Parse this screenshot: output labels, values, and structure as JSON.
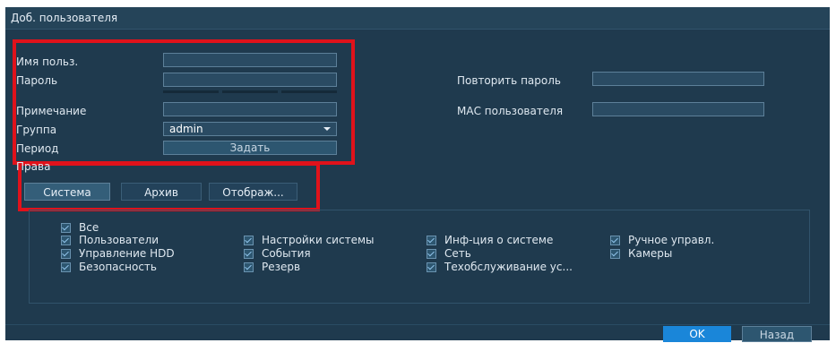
{
  "title": "Доб. пользователя",
  "form": {
    "username_label": "Имя польз.",
    "password_label": "Пароль",
    "note_label": "Примечание",
    "group_label": "Группа",
    "group_value": "admin",
    "period_label": "Период",
    "period_button": "Задать",
    "repeat_password_label": "Повторить пароль",
    "mac_label": "МАС пользователя"
  },
  "rights_label": "Права",
  "tabs": [
    {
      "label": "Система",
      "active": true
    },
    {
      "label": "Архив",
      "active": false
    },
    {
      "label": "Отображ...",
      "active": false
    }
  ],
  "permissions": {
    "all": "Все",
    "col1": [
      "Пользователи",
      "Управление HDD",
      "Безопасность"
    ],
    "col2": [
      "Настройки системы",
      "События",
      "Резерв"
    ],
    "col3": [
      "Инф-ция о системе",
      "Сеть",
      "Техобслуживание ус..."
    ],
    "col4": [
      "Ручное управл.",
      "Камеры"
    ]
  },
  "footer": {
    "ok": "OK",
    "back": "Назад"
  },
  "colors": {
    "background": "#1f3a4e",
    "highlight": "#e0121b",
    "ok_button": "#1a86d9"
  }
}
